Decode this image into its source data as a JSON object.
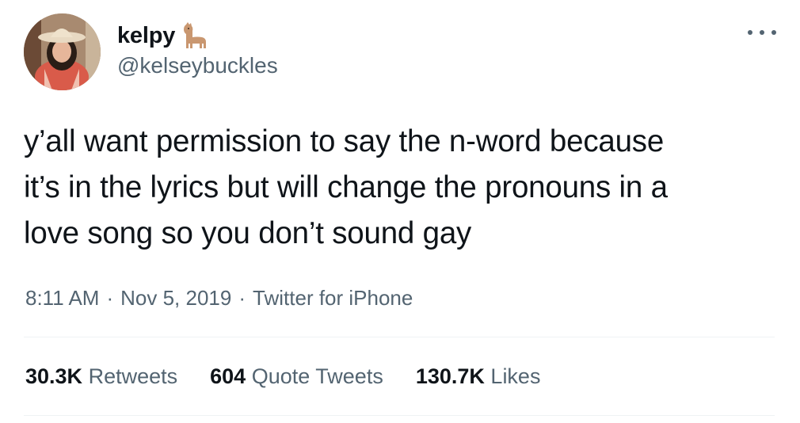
{
  "author": {
    "display_name": "kelpy",
    "name_emoji": "llama-icon",
    "handle": "@kelseybuckles"
  },
  "tweet": {
    "text": "y’all want permission to say the n-word because\nit’s in the lyrics but will change the pronouns in a\nlove song so you don’t sound gay",
    "time": "8:11 AM",
    "separator": "·",
    "date": "Nov 5, 2019",
    "source": "Twitter for iPhone"
  },
  "stats": {
    "retweets": {
      "count": "30.3K",
      "label": "Retweets"
    },
    "quotes": {
      "count": "604",
      "label": "Quote Tweets"
    },
    "likes": {
      "count": "130.7K",
      "label": "Likes"
    }
  },
  "icons": {
    "more": "more-horizontal-icon",
    "avatar": "profile-photo"
  },
  "colors": {
    "text": "#0f1419",
    "secondary": "#536471",
    "divider": "#eff3f4"
  }
}
